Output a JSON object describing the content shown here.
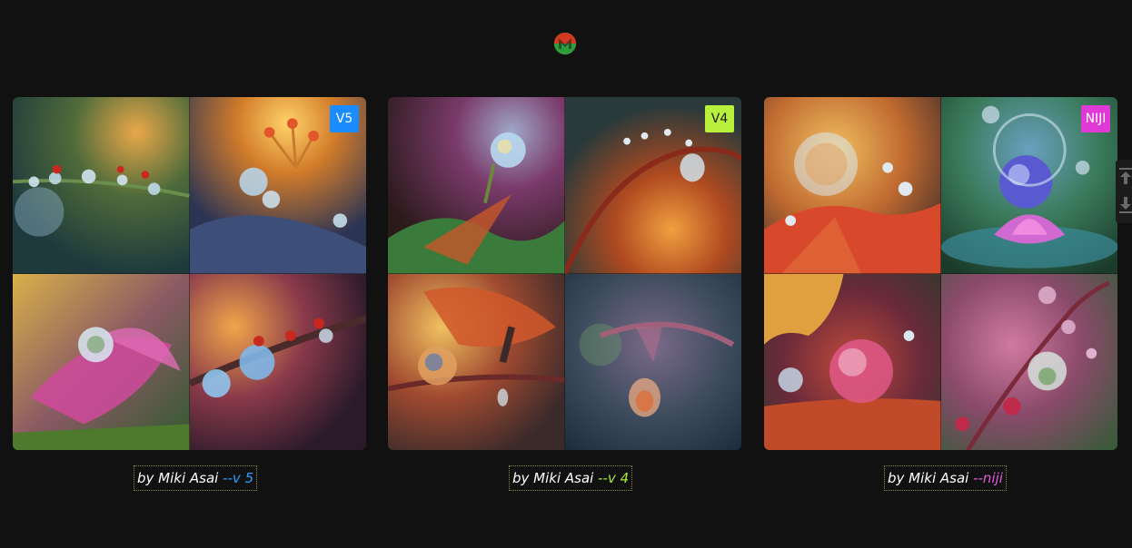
{
  "brand": {
    "logo_icon": "midjourney-m-logo-icon",
    "colors": {
      "logo_red": "#d23a1f",
      "logo_green": "#2e9e3c",
      "logo_yellow": "#d8b12a"
    }
  },
  "gallery": [
    {
      "badge": "V5",
      "badge_color": "#1a8cff",
      "caption_prefix": "by Miki Asai ",
      "caption_flag": "--v 5",
      "flag_color": "#2d9bff"
    },
    {
      "badge": "V4",
      "badge_color": "#b8f03c",
      "caption_prefix": "by Miki Asai ",
      "caption_flag": "--v 4",
      "flag_color": "#a6e83a"
    },
    {
      "badge": "NIJI",
      "badge_color": "#e03ad6",
      "caption_prefix": "by Miki Asai ",
      "caption_flag": "--niji",
      "flag_color": "#e25ad8"
    }
  ],
  "side_tools": {
    "top_icon": "scroll-top-icon",
    "bottom_icon": "download-icon"
  }
}
